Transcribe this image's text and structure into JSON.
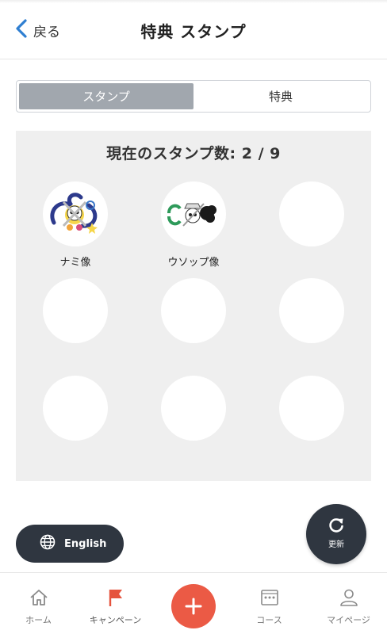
{
  "header": {
    "back_label": "戻る",
    "title": "特典 スタンプ"
  },
  "tabs": {
    "stamp_label": "スタンプ",
    "benefit_label": "特典",
    "active": "stamp"
  },
  "stamp_panel": {
    "count_text": "現在のスタンプ数: 2 / 9",
    "collected": 2,
    "total": 9,
    "stamps": [
      {
        "label": "ナミ像",
        "icon": "nami-jolly-roger-icon",
        "collected": true
      },
      {
        "label": "ウソップ像",
        "icon": "usopp-jolly-roger-icon",
        "collected": true
      },
      {
        "label": "",
        "collected": false
      },
      {
        "label": "",
        "collected": false
      },
      {
        "label": "",
        "collected": false
      },
      {
        "label": "",
        "collected": false
      },
      {
        "label": "",
        "collected": false
      },
      {
        "label": "",
        "collected": false
      },
      {
        "label": "",
        "collected": false
      }
    ]
  },
  "language_button": {
    "label": "English",
    "icon": "globe-icon"
  },
  "refresh_button": {
    "label": "更新",
    "icon": "refresh-icon"
  },
  "bottom_nav": {
    "items": [
      {
        "label": "ホーム",
        "icon": "home-icon"
      },
      {
        "label": "キャンペーン",
        "icon": "flag-icon"
      },
      {
        "label": "",
        "icon": "plus-icon"
      },
      {
        "label": "コース",
        "icon": "course-map-icon"
      },
      {
        "label": "マイページ",
        "icon": "person-icon"
      }
    ]
  },
  "colors": {
    "accent_blue": "#2f7fd1",
    "segment_active": "#a1a7ae",
    "panel_bg": "#efefef",
    "dark_button": "#2f3640",
    "fab_red": "#eb5a45",
    "campaign_red": "#e5533d"
  }
}
